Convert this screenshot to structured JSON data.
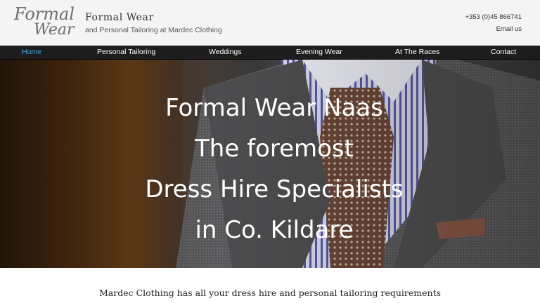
{
  "header": {
    "logo": {
      "line1": "Formal",
      "line2": "Wear"
    },
    "title": "Formal Wear",
    "tagline": "and Personal Tailoring at Mardec Clothing",
    "phone": "+353 (0)45 866741",
    "email_label": "Email us"
  },
  "nav": {
    "items": [
      {
        "label": "Home",
        "active": true
      },
      {
        "label": "Personal Tailoring"
      },
      {
        "label": "Weddings"
      },
      {
        "label": "Evening Wear"
      },
      {
        "label": "At The Races"
      },
      {
        "label": "Contact"
      }
    ],
    "active_color": "#4aa8e6"
  },
  "hero": {
    "lines": [
      "Formal Wear Naas",
      "The foremost",
      "Dress Hire Specialists",
      "in Co. Kildare"
    ]
  },
  "intro": {
    "text": "Mardec Clothing has all your dress hire and personal tailoring requirements"
  }
}
